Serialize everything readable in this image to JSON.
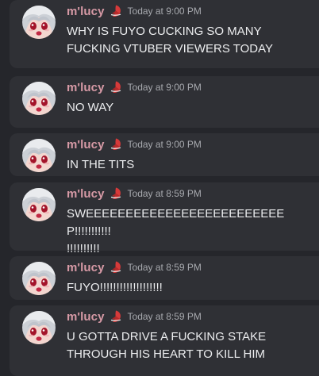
{
  "messages": [
    {
      "username": "m'lucy",
      "role_icon": "red-crescent-icon",
      "timestamp": "Today at 9:00 PM",
      "content": "WHY IS FUYO CUCKING SO MANY\nFUCKING VTUBER VIEWERS TODAY"
    },
    {
      "username": "m'lucy",
      "role_icon": "red-crescent-icon",
      "timestamp": "Today at 9:00 PM",
      "content": "NO WAY"
    },
    {
      "username": "m'lucy",
      "role_icon": "red-crescent-icon",
      "timestamp": "Today at 9:00 PM",
      "content": "IN THE TITS"
    },
    {
      "username": "m'lucy",
      "role_icon": "red-crescent-icon",
      "timestamp": "Today at 8:59 PM",
      "content": "SWEEEEEEEEEEEEEEEEEEEEEEEEEP!!!!!!!!!!!\n!!!!!!!!!!"
    },
    {
      "username": "m'lucy",
      "role_icon": "red-crescent-icon",
      "timestamp": "Today at 8:59 PM",
      "content": "FUYO!!!!!!!!!!!!!!!!!!!"
    },
    {
      "username": "m'lucy",
      "role_icon": "red-crescent-icon",
      "timestamp": "Today at 8:59 PM",
      "content": "U GOTTA DRIVE A FUCKING STAKE\nTHROUGH HIS HEART TO KILL HIM"
    }
  ],
  "colors": {
    "background": "#25262b",
    "card": "#2f3035",
    "username": "#d79aa6",
    "timestamp": "#a7a9ae",
    "text": "#ecedef",
    "role_icon": "#d63a3a"
  }
}
